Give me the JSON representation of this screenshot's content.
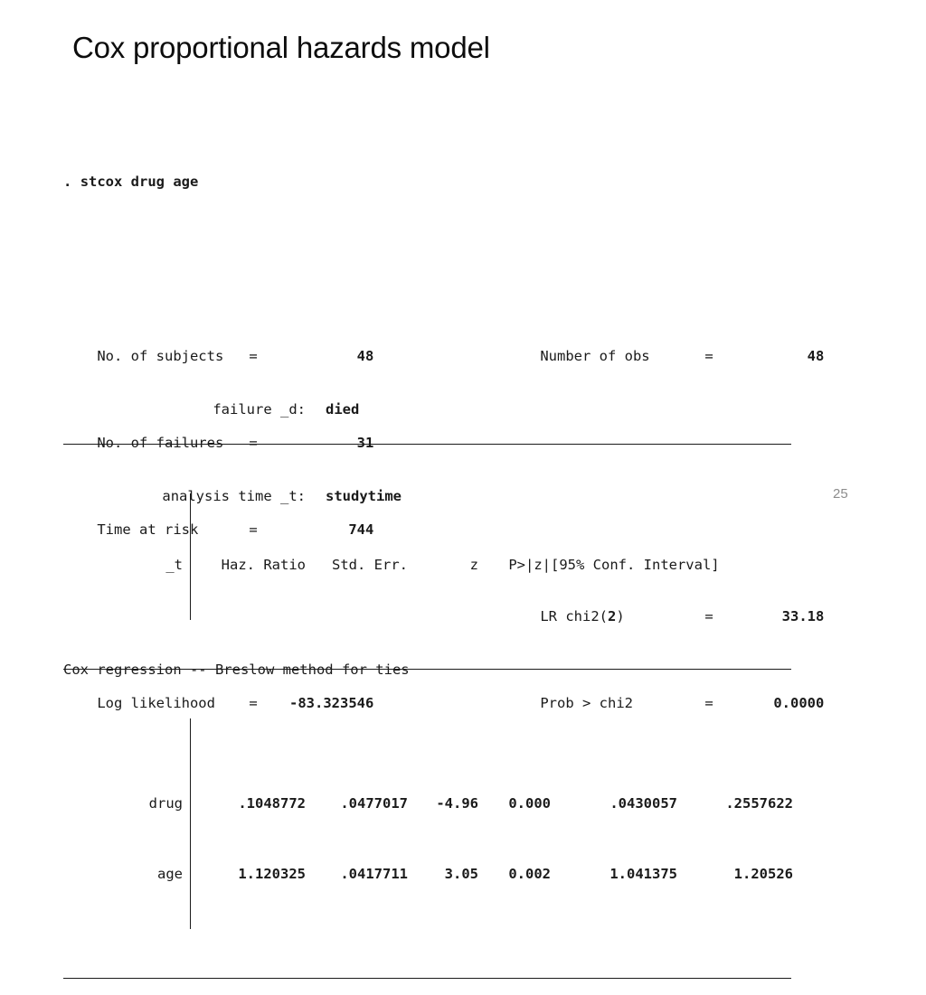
{
  "slide": {
    "title": "Cox proportional hazards model",
    "page_number": "25",
    "background_color": "#ffffff",
    "text_color": "#1a1a1a",
    "page_number_color": "#8c8c8c"
  },
  "console": {
    "prompt": ".",
    "command": "stcox drug age",
    "failure_label": "failure _d:",
    "failure_value": "died",
    "analysis_time_label": "analysis time _t:",
    "analysis_time_value": "studytime",
    "model_line": "Cox regression -- Breslow method for ties"
  },
  "stats": {
    "left": [
      {
        "name": "No. of subjects",
        "eq": "=",
        "value": "48"
      },
      {
        "name": "No. of failures",
        "eq": "=",
        "value": "31"
      },
      {
        "name": "Time at risk",
        "eq": "=",
        "value": "744"
      },
      {
        "name": "Log likelihood",
        "eq": "=",
        "value": "-83.323546"
      }
    ],
    "right": [
      {
        "name": "Number of obs",
        "eq": "=",
        "value": "48"
      },
      {
        "name_prefix": "LR chi2(",
        "name_bold": "2",
        "name_suffix": ")",
        "eq": "=",
        "value": "33.18"
      },
      {
        "name": "Prob > chi2",
        "eq": "=",
        "value": "0.0000"
      }
    ]
  },
  "table": {
    "headers": {
      "stub": "_t",
      "haz_ratio": "Haz. Ratio",
      "std_err": "Std. Err.",
      "z": "z",
      "p": "P>|z|",
      "conf_interval": "[95% Conf. Interval]"
    },
    "rows": [
      {
        "term": "drug",
        "haz_ratio": ".1048772",
        "std_err": ".0477017",
        "z": "-4.96",
        "p": "0.000",
        "ci_low": ".0430057",
        "ci_high": ".2557622"
      },
      {
        "term": "age",
        "haz_ratio": "1.120325",
        "std_err": ".0417711",
        "z": "3.05",
        "p": "0.002",
        "ci_low": "1.041375",
        "ci_high": "1.20526"
      }
    ]
  }
}
